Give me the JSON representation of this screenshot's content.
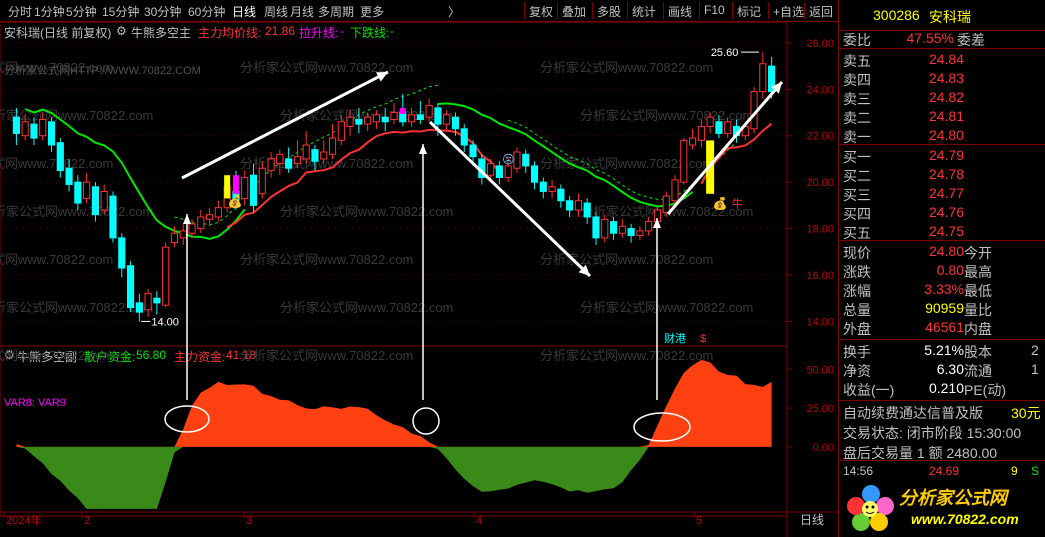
{
  "toolbar": {
    "left": [
      {
        "label": "分时",
        "active": false
      },
      {
        "label": "1分钟",
        "active": false
      },
      {
        "label": "5分钟",
        "active": false
      },
      {
        "label": "15分钟",
        "active": false
      },
      {
        "label": "30分钟",
        "active": false
      },
      {
        "label": "60分钟",
        "active": false
      },
      {
        "label": "日线",
        "active": true
      },
      {
        "label": "周线",
        "active": false
      },
      {
        "label": "月线",
        "active": false
      },
      {
        "label": "多周期",
        "active": false
      },
      {
        "label": "更多",
        "active": false
      }
    ],
    "more_arrow": "〉",
    "right": [
      "复权",
      "叠加",
      "多股",
      "统计",
      "画线",
      "F10",
      "标记",
      "+自选",
      "返回"
    ]
  },
  "main_title": {
    "stock": "安科瑞(日线 前复权)",
    "indicator": "牛熊多空主",
    "avg_label": "主力均价线:",
    "avg_value": "21.86",
    "up_label": "拉升线:",
    "up_value": "-",
    "down_label": "下跌线:",
    "down_value": "-"
  },
  "sub_title": {
    "indicator": "牛熊多空副",
    "retail_label": "散户资金:",
    "retail_value": "56.80",
    "main_label": "主力资金:",
    "main_value": "41.18",
    "var_label": "VAR8: VAR9"
  },
  "watermark": {
    "site": "分析家公式网www.70822.com",
    "site_short": "分析家公式网HTTP://WWW.70822.COM"
  },
  "annotations": {
    "high_label": "25.60",
    "low_label": "14.00",
    "badge_caigang": "财港",
    "badge_s": "$",
    "niu": "牛"
  },
  "chart_data": [
    {
      "type": "candlestick",
      "title": "安科瑞(日线 前复权)",
      "ylim": [
        13.2,
        26.9
      ],
      "y_ticks": [
        14.0,
        16.0,
        18.0,
        20.0,
        22.0,
        24.0,
        26.0
      ],
      "x_ticks": [
        "2024年",
        "2",
        "3",
        "4",
        "5"
      ],
      "candles": [
        {
          "o": 22.8,
          "c": 22.1,
          "h": 23.2,
          "l": 21.6
        },
        {
          "o": 22.0,
          "c": 22.6,
          "h": 22.9,
          "l": 21.8
        },
        {
          "o": 22.5,
          "c": 21.9,
          "h": 22.8,
          "l": 21.6
        },
        {
          "o": 22.0,
          "c": 22.7,
          "h": 23.0,
          "l": 21.8
        },
        {
          "o": 22.6,
          "c": 21.6,
          "h": 22.8,
          "l": 21.3
        },
        {
          "o": 21.7,
          "c": 20.5,
          "h": 21.9,
          "l": 20.2
        },
        {
          "o": 20.6,
          "c": 19.9,
          "h": 21.0,
          "l": 19.6
        },
        {
          "o": 20.0,
          "c": 19.1,
          "h": 20.3,
          "l": 18.8
        },
        {
          "o": 19.3,
          "c": 20.0,
          "h": 20.4,
          "l": 19.1
        },
        {
          "o": 19.8,
          "c": 18.6,
          "h": 20.0,
          "l": 18.3
        },
        {
          "o": 18.8,
          "c": 19.6,
          "h": 19.9,
          "l": 18.6
        },
        {
          "o": 19.4,
          "c": 17.6,
          "h": 19.6,
          "l": 17.4
        },
        {
          "o": 17.6,
          "c": 16.3,
          "h": 17.8,
          "l": 15.9
        },
        {
          "o": 16.4,
          "c": 14.6,
          "h": 16.6,
          "l": 14.4
        },
        {
          "o": 14.8,
          "c": 14.4,
          "h": 15.2,
          "l": 14.0
        },
        {
          "o": 14.5,
          "c": 15.2,
          "h": 15.4,
          "l": 14.2
        },
        {
          "o": 15.0,
          "c": 14.8,
          "h": 15.3,
          "l": 14.3
        },
        {
          "o": 14.7,
          "c": 17.2,
          "h": 17.4,
          "l": 14.6
        },
        {
          "o": 17.4,
          "c": 17.8,
          "h": 18.1,
          "l": 17.2
        },
        {
          "o": 17.6,
          "c": 17.9,
          "h": 18.2,
          "l": 17.3
        },
        {
          "o": 17.8,
          "c": 18.2,
          "h": 18.4,
          "l": 17.6
        },
        {
          "o": 18.0,
          "c": 18.5,
          "h": 18.8,
          "l": 17.8
        },
        {
          "o": 18.4,
          "c": 18.6,
          "h": 18.9,
          "l": 18.1
        },
        {
          "o": 18.5,
          "c": 18.9,
          "h": 19.2,
          "l": 18.3
        },
        {
          "o": 18.9,
          "c": 19.8,
          "h": 20.0,
          "l": 18.7
        },
        {
          "o": 19.6,
          "c": 19.2,
          "h": 20.5,
          "l": 18.8
        },
        {
          "o": 19.3,
          "c": 20.2,
          "h": 20.5,
          "l": 19.0
        },
        {
          "o": 20.3,
          "c": 19.0,
          "h": 20.8,
          "l": 18.7
        },
        {
          "o": 19.5,
          "c": 20.6,
          "h": 20.9,
          "l": 19.3
        },
        {
          "o": 20.5,
          "c": 21.0,
          "h": 21.3,
          "l": 20.2
        },
        {
          "o": 20.8,
          "c": 21.2,
          "h": 21.4,
          "l": 20.3
        },
        {
          "o": 21.0,
          "c": 20.6,
          "h": 21.5,
          "l": 20.4
        },
        {
          "o": 20.8,
          "c": 21.1,
          "h": 21.8,
          "l": 20.6
        },
        {
          "o": 21.0,
          "c": 21.6,
          "h": 22.2,
          "l": 20.8
        },
        {
          "o": 21.4,
          "c": 20.9,
          "h": 21.6,
          "l": 20.5
        },
        {
          "o": 21.0,
          "c": 21.3,
          "h": 21.8,
          "l": 20.8
        },
        {
          "o": 21.2,
          "c": 21.9,
          "h": 22.5,
          "l": 21.0
        },
        {
          "o": 21.8,
          "c": 22.6,
          "h": 22.9,
          "l": 21.6
        },
        {
          "o": 22.4,
          "c": 22.8,
          "h": 23.1,
          "l": 22.0
        },
        {
          "o": 22.7,
          "c": 22.5,
          "h": 23.2,
          "l": 22.1
        },
        {
          "o": 22.5,
          "c": 22.8,
          "h": 23.0,
          "l": 22.2
        },
        {
          "o": 22.6,
          "c": 22.9,
          "h": 23.1,
          "l": 22.3
        },
        {
          "o": 22.8,
          "c": 22.6,
          "h": 23.2,
          "l": 22.2
        },
        {
          "o": 22.7,
          "c": 23.0,
          "h": 23.4,
          "l": 22.5
        },
        {
          "o": 23.0,
          "c": 22.6,
          "h": 23.8,
          "l": 22.4
        },
        {
          "o": 22.6,
          "c": 22.9,
          "h": 23.2,
          "l": 22.4
        },
        {
          "o": 22.9,
          "c": 22.7,
          "h": 23.5,
          "l": 22.5
        },
        {
          "o": 22.8,
          "c": 23.3,
          "h": 23.6,
          "l": 22.6
        },
        {
          "o": 23.2,
          "c": 22.5,
          "h": 23.4,
          "l": 22.0
        },
        {
          "o": 22.5,
          "c": 22.9,
          "h": 23.1,
          "l": 22.2
        },
        {
          "o": 22.8,
          "c": 22.3,
          "h": 23.0,
          "l": 22.0
        },
        {
          "o": 22.3,
          "c": 21.6,
          "h": 22.5,
          "l": 21.3
        },
        {
          "o": 21.6,
          "c": 21.1,
          "h": 21.8,
          "l": 20.7
        },
        {
          "o": 21.0,
          "c": 20.2,
          "h": 21.2,
          "l": 19.9
        },
        {
          "o": 20.3,
          "c": 20.8,
          "h": 21.0,
          "l": 20.0
        },
        {
          "o": 20.7,
          "c": 20.2,
          "h": 20.9,
          "l": 19.9
        },
        {
          "o": 20.2,
          "c": 20.7,
          "h": 21.1,
          "l": 20.0
        },
        {
          "o": 20.6,
          "c": 21.3,
          "h": 21.5,
          "l": 20.4
        },
        {
          "o": 21.2,
          "c": 20.7,
          "h": 21.4,
          "l": 20.4
        },
        {
          "o": 20.7,
          "c": 20.0,
          "h": 20.9,
          "l": 19.7
        },
        {
          "o": 20.0,
          "c": 19.6,
          "h": 20.2,
          "l": 19.3
        },
        {
          "o": 19.6,
          "c": 19.8,
          "h": 20.1,
          "l": 19.3
        },
        {
          "o": 19.7,
          "c": 19.2,
          "h": 19.9,
          "l": 18.9
        },
        {
          "o": 19.2,
          "c": 18.8,
          "h": 19.4,
          "l": 18.5
        },
        {
          "o": 18.8,
          "c": 19.2,
          "h": 19.5,
          "l": 18.5
        },
        {
          "o": 19.1,
          "c": 18.5,
          "h": 19.3,
          "l": 18.2
        },
        {
          "o": 18.5,
          "c": 17.6,
          "h": 18.7,
          "l": 17.3
        },
        {
          "o": 17.6,
          "c": 18.4,
          "h": 18.6,
          "l": 17.4
        },
        {
          "o": 18.3,
          "c": 17.8,
          "h": 18.5,
          "l": 17.5
        },
        {
          "o": 17.8,
          "c": 18.1,
          "h": 18.4,
          "l": 17.6
        },
        {
          "o": 18.0,
          "c": 17.7,
          "h": 18.2,
          "l": 17.4
        },
        {
          "o": 17.7,
          "c": 17.9,
          "h": 18.1,
          "l": 17.5
        },
        {
          "o": 17.9,
          "c": 18.3,
          "h": 18.5,
          "l": 17.7
        },
        {
          "o": 18.3,
          "c": 18.8,
          "h": 19.0,
          "l": 18.1
        },
        {
          "o": 18.7,
          "c": 19.4,
          "h": 19.6,
          "l": 18.5
        },
        {
          "o": 19.2,
          "c": 20.1,
          "h": 20.3,
          "l": 19.0
        },
        {
          "o": 20.0,
          "c": 21.8,
          "h": 21.9,
          "l": 19.9
        },
        {
          "o": 21.6,
          "c": 21.9,
          "h": 22.3,
          "l": 21.4
        },
        {
          "o": 21.8,
          "c": 22.4,
          "h": 22.7,
          "l": 21.5
        },
        {
          "o": 22.4,
          "c": 22.8,
          "h": 23.0,
          "l": 22.1
        },
        {
          "o": 22.6,
          "c": 22.1,
          "h": 22.9,
          "l": 21.9
        },
        {
          "o": 22.1,
          "c": 22.6,
          "h": 22.8,
          "l": 21.9
        },
        {
          "o": 22.4,
          "c": 22.0,
          "h": 22.7,
          "l": 21.7
        },
        {
          "o": 22.0,
          "c": 22.4,
          "h": 22.6,
          "l": 21.8
        },
        {
          "o": 22.3,
          "c": 23.9,
          "h": 24.1,
          "l": 22.1
        },
        {
          "o": 23.9,
          "c": 25.1,
          "h": 25.6,
          "l": 23.6
        },
        {
          "o": 25.0,
          "c": 23.9,
          "h": 25.4,
          "l": 23.6
        }
      ],
      "series": [
        {
          "name": "主力均价线",
          "color": "#ff3232"
        },
        {
          "name": "拉升线",
          "color": "#00e600"
        },
        {
          "name": "下跌线",
          "color": "#00e600"
        }
      ]
    },
    {
      "type": "area",
      "title": "牛熊多空副",
      "ylim": [
        -42,
        65
      ],
      "y_ticks": [
        0.0,
        25.0,
        50.0
      ],
      "series": [
        {
          "name": "散户资金",
          "color": "#00e600"
        },
        {
          "name": "主力资金",
          "color": "#ff3232"
        }
      ]
    }
  ],
  "side": {
    "code": "300286",
    "name": "安科瑞",
    "webi_label": "委比",
    "webi_value": "47.55%",
    "wecha_label": "委差",
    "asks": [
      {
        "label": "卖五",
        "price": "24.84"
      },
      {
        "label": "卖四",
        "price": "24.83"
      },
      {
        "label": "卖三",
        "price": "24.82"
      },
      {
        "label": "卖二",
        "price": "24.81"
      },
      {
        "label": "卖一",
        "price": "24.80"
      }
    ],
    "bids": [
      {
        "label": "买一",
        "price": "24.79"
      },
      {
        "label": "买二",
        "price": "24.78"
      },
      {
        "label": "买三",
        "price": "24.77"
      },
      {
        "label": "买四",
        "price": "24.76"
      },
      {
        "label": "买五",
        "price": "24.75"
      }
    ],
    "stats": [
      {
        "l": "现价",
        "v": "24.80",
        "c": "red",
        "l2": "今开"
      },
      {
        "l": "涨跌",
        "v": "0.80",
        "c": "red",
        "l2": "最高"
      },
      {
        "l": "涨幅",
        "v": "3.33%",
        "c": "red",
        "l2": "最低"
      },
      {
        "l": "总量",
        "v": "90959",
        "c": "yellow",
        "l2": "量比"
      },
      {
        "l": "外盘",
        "v": "46561",
        "c": "red",
        "l2": "内盘"
      }
    ],
    "stats2": [
      {
        "l": "换手",
        "v": "5.21%",
        "c": "white",
        "l2": "股本",
        "v2": "2"
      },
      {
        "l": "净资",
        "v": "6.30",
        "c": "white",
        "l2": "流通",
        "v2": "1"
      },
      {
        "l": "收益(一)",
        "v": "0.210",
        "c": "white",
        "l2": "PE(动)",
        "v2": ""
      }
    ],
    "promo": "自动续费通达信普及版",
    "promo2": "30元",
    "trade_status": "交易状态: 闭市阶段 15:30:00",
    "after_trade": "盘后交易量 1 额 2480.00",
    "tick_time": "14:56",
    "tick_price": "24.69",
    "tick_vol": "9",
    "tick_flag": "S",
    "logo_text": "分析家公式网",
    "logo_url": "www.70822.com"
  },
  "bottom": {
    "period": "日线"
  }
}
